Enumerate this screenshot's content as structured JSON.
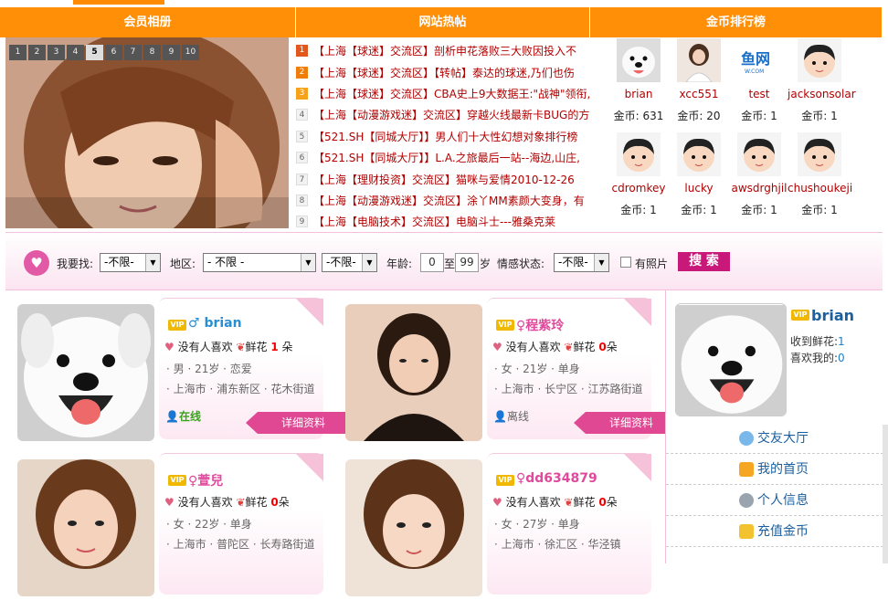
{
  "header": {
    "members": "会员相册",
    "hot": "网站热帖",
    "rank": "金币排行榜"
  },
  "album": {
    "pages": [
      "1",
      "2",
      "3",
      "4",
      "5",
      "6",
      "7",
      "8",
      "9",
      "10"
    ],
    "current": "5"
  },
  "posts": [
    {
      "n": "1",
      "text": "【上海【球迷】交流区】剖析申花落败三大败因投入不"
    },
    {
      "n": "2",
      "text": "【上海【球迷】交流区】【转帖】泰达的球迷,乃们也伤"
    },
    {
      "n": "3",
      "text": "【上海【球迷】交流区】CBA史上9大数据王:\"战神\"领衔,"
    },
    {
      "n": "4",
      "text": "【上海【动漫游戏迷】交流区】穿越火线最新卡BUG的方"
    },
    {
      "n": "5",
      "text": "【521.SH【同城大厅】】男人们十大性幻想对象排行榜"
    },
    {
      "n": "6",
      "text": "【521.SH【同城大厅】】L.A.之旅最后一站--海边,山庄,"
    },
    {
      "n": "7",
      "text": "【上海【理财投资】交流区】猫咪与爱情2010-12-26"
    },
    {
      "n": "8",
      "text": "【上海【动漫游戏迷】交流区】涂丫MM素颜大变身，有"
    },
    {
      "n": "9",
      "text": "【上海【电脑技术】交流区】电脑斗士---雅桑克莱"
    }
  ],
  "gold_label": "金币:",
  "ranking": [
    {
      "name": "brian",
      "gold": "631",
      "avatar": "dog"
    },
    {
      "name": "xcc551",
      "gold": "20",
      "avatar": "girl"
    },
    {
      "name": "test",
      "gold": "1",
      "avatar": "fish-logo"
    },
    {
      "name": "jacksonsolar",
      "gold": "1",
      "avatar": "cartoon"
    },
    {
      "name": "cdromkey",
      "gold": "1",
      "avatar": "cartoon"
    },
    {
      "name": "lucky",
      "gold": "1",
      "avatar": "cartoon"
    },
    {
      "name": "awsdrghjil",
      "gold": "1",
      "avatar": "cartoon"
    },
    {
      "name": "chushoukeji",
      "gold": "1",
      "avatar": "cartoon"
    }
  ],
  "search": {
    "find_label": "我要找:",
    "find": "-不限-",
    "area_label": "地区:",
    "area1": "- 不限 -",
    "area2": "-不限-",
    "age_label": "年龄:",
    "age_from": "0",
    "to": "至",
    "age_to": "99",
    "age_unit": "岁",
    "emo_label": "情感状态:",
    "emo": "-不限-",
    "photo_label": "有照片",
    "btn": "搜 索"
  },
  "cards": [
    {
      "name": "brian",
      "sex": "♂",
      "like": "没有人喜欢",
      "flower_label": "鲜花",
      "flowers": "1",
      "unit": "朵",
      "info": "· 男 · 21岁 · 恋爱",
      "loc": "· 上海市 · 浦东新区 · 花木街道",
      "status": "在线",
      "detail": "详细资料"
    },
    {
      "name": "程紫玲",
      "sex": "♀",
      "like": "没有人喜欢",
      "flower_label": "鲜花",
      "flowers": "0",
      "unit": "朵",
      "info": "· 女 · 21岁 · 单身",
      "loc": "· 上海市 · 长宁区 · 江苏路街道",
      "status": "离线",
      "detail": "详细资料"
    },
    {
      "name": "萱兒",
      "sex": "♀",
      "like": "没有人喜欢",
      "flower_label": "鲜花",
      "flowers": "0",
      "unit": "朵",
      "info": "· 女 · 22岁 · 单身",
      "loc": "· 上海市 · 普陀区 · 长寿路街道"
    },
    {
      "name": "dd634879",
      "sex": "♀",
      "like": "没有人喜欢",
      "flower_label": "鲜花",
      "flowers": "0",
      "unit": "朵",
      "info": "· 女 · 27岁 · 单身",
      "loc": "· 上海市 · 徐汇区 · 华泾镇"
    }
  ],
  "profile": {
    "name": "brian",
    "flowers_label": "收到鲜花:",
    "flowers": "1",
    "likes_label": "喜欢我的:",
    "likes": "0"
  },
  "menu": [
    "交友大厅",
    "我的首页",
    "个人信息",
    "充值金币"
  ],
  "vip": "VIP"
}
